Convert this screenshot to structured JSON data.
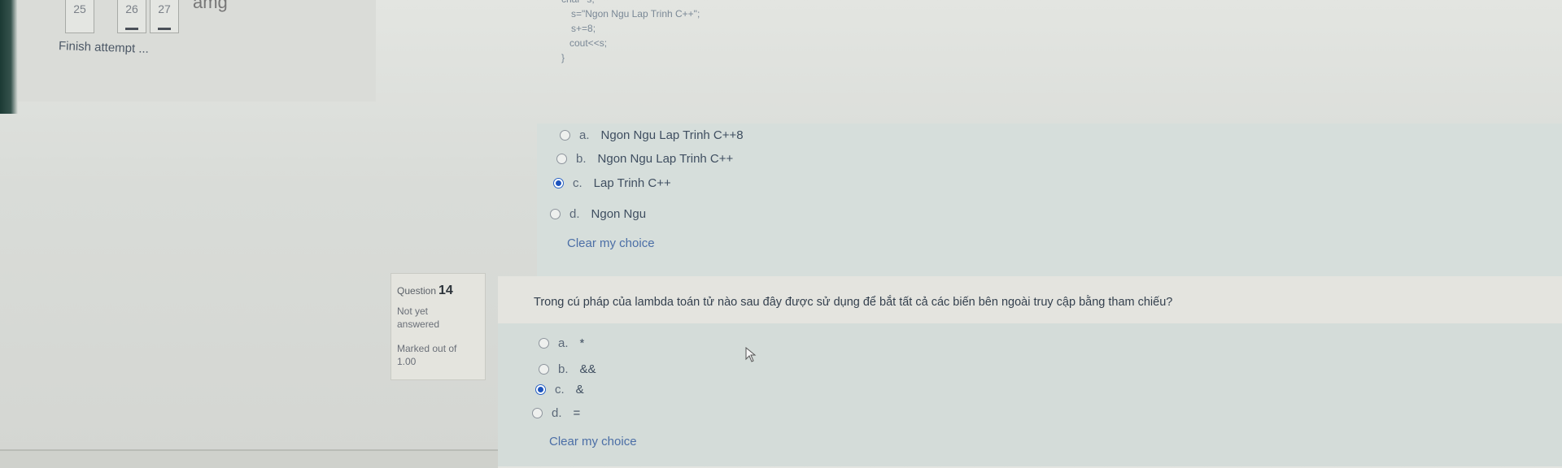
{
  "nav": {
    "buttons": [
      "25",
      "26",
      "27"
    ],
    "fragment": "amg",
    "finish_link": "Finish attempt ..."
  },
  "q13": {
    "code_lines": [
      "char *s;",
      "s=\"Ngon Ngu Lap Trinh C++\";",
      "s+=8;",
      "cout<<s;",
      "}"
    ],
    "answers": [
      {
        "letter": "a.",
        "text": "Ngon Ngu Lap Trinh C++8",
        "checked": false
      },
      {
        "letter": "b.",
        "text": "Ngon Ngu Lap Trinh C++",
        "checked": false
      },
      {
        "letter": "c.",
        "text": "Lap Trinh C++",
        "checked": true
      },
      {
        "letter": "d.",
        "text": "Ngon Ngu",
        "checked": false
      }
    ],
    "clear_label": "Clear my choice"
  },
  "q14": {
    "label": "Question",
    "number": "14",
    "state": "Not yet answered",
    "grade": "Marked out of 1.00",
    "text": "Trong cú pháp của lambda toán tử nào sau đây được sử dụng để bắt tất cả các biến bên ngoài truy cập bằng tham chiếu?",
    "answers": [
      {
        "letter": "a.",
        "text": "*",
        "checked": false
      },
      {
        "letter": "b.",
        "text": "&&",
        "checked": false
      },
      {
        "letter": "c.",
        "text": "&",
        "checked": true
      },
      {
        "letter": "d.",
        "text": "=",
        "checked": false
      }
    ],
    "clear_label": "Clear my choice"
  },
  "colors": {
    "accent": "#1c53be",
    "link": "#4b6ea6",
    "text": "#34404e"
  }
}
